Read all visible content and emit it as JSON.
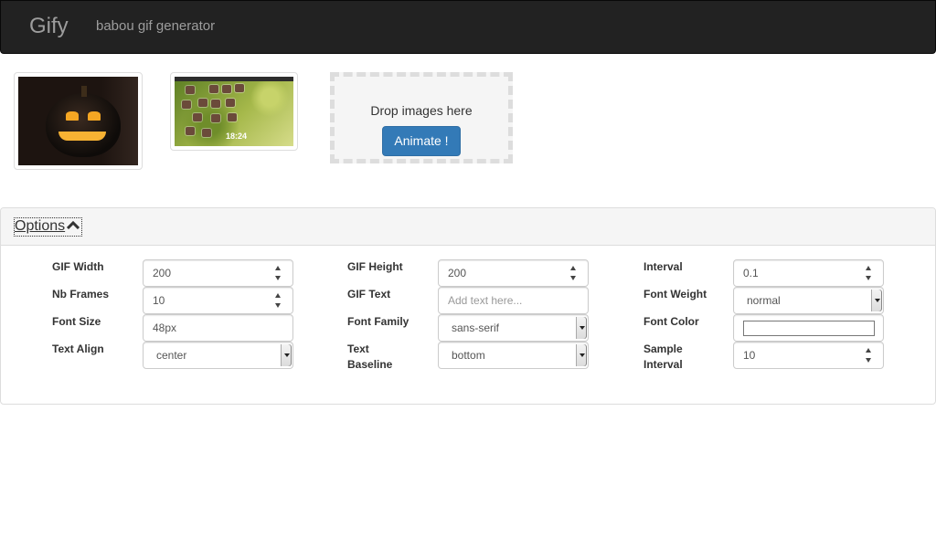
{
  "navbar": {
    "brand": "Gify",
    "subtitle": "babou gif generator"
  },
  "images": [
    {
      "name": "pumpkin-thumbnail"
    },
    {
      "name": "meadow-thumbnail",
      "clock": "18:24"
    }
  ],
  "dropzone": {
    "text": "Drop images here",
    "animate_label": "Animate !"
  },
  "options": {
    "title": "Options",
    "gif_width": {
      "label": "GIF Width",
      "value": "200"
    },
    "gif_height": {
      "label": "GIF Height",
      "value": "200"
    },
    "interval": {
      "label": "Interval",
      "value": "0.1"
    },
    "nb_frames": {
      "label": "Nb Frames",
      "value": "10"
    },
    "gif_text": {
      "label": "GIF Text",
      "value": "",
      "placeholder": "Add text here..."
    },
    "font_weight": {
      "label": "Font Weight",
      "value": "normal"
    },
    "font_size": {
      "label": "Font Size",
      "value": "48px"
    },
    "font_family": {
      "label": "Font Family",
      "value": "sans-serif"
    },
    "font_color": {
      "label": "Font Color",
      "value": "#ffffff"
    },
    "text_align": {
      "label": "Text Align",
      "value": "center"
    },
    "text_baseline": {
      "label_line1": "Text",
      "label_line2": "Baseline",
      "value": "bottom"
    },
    "sample_interval": {
      "label_line1": "Sample",
      "label_line2": "Interval",
      "value": "10"
    }
  },
  "colors": {
    "navbar_bg": "#222222",
    "primary": "#337ab7",
    "panel_heading_bg": "#f5f5f5"
  }
}
